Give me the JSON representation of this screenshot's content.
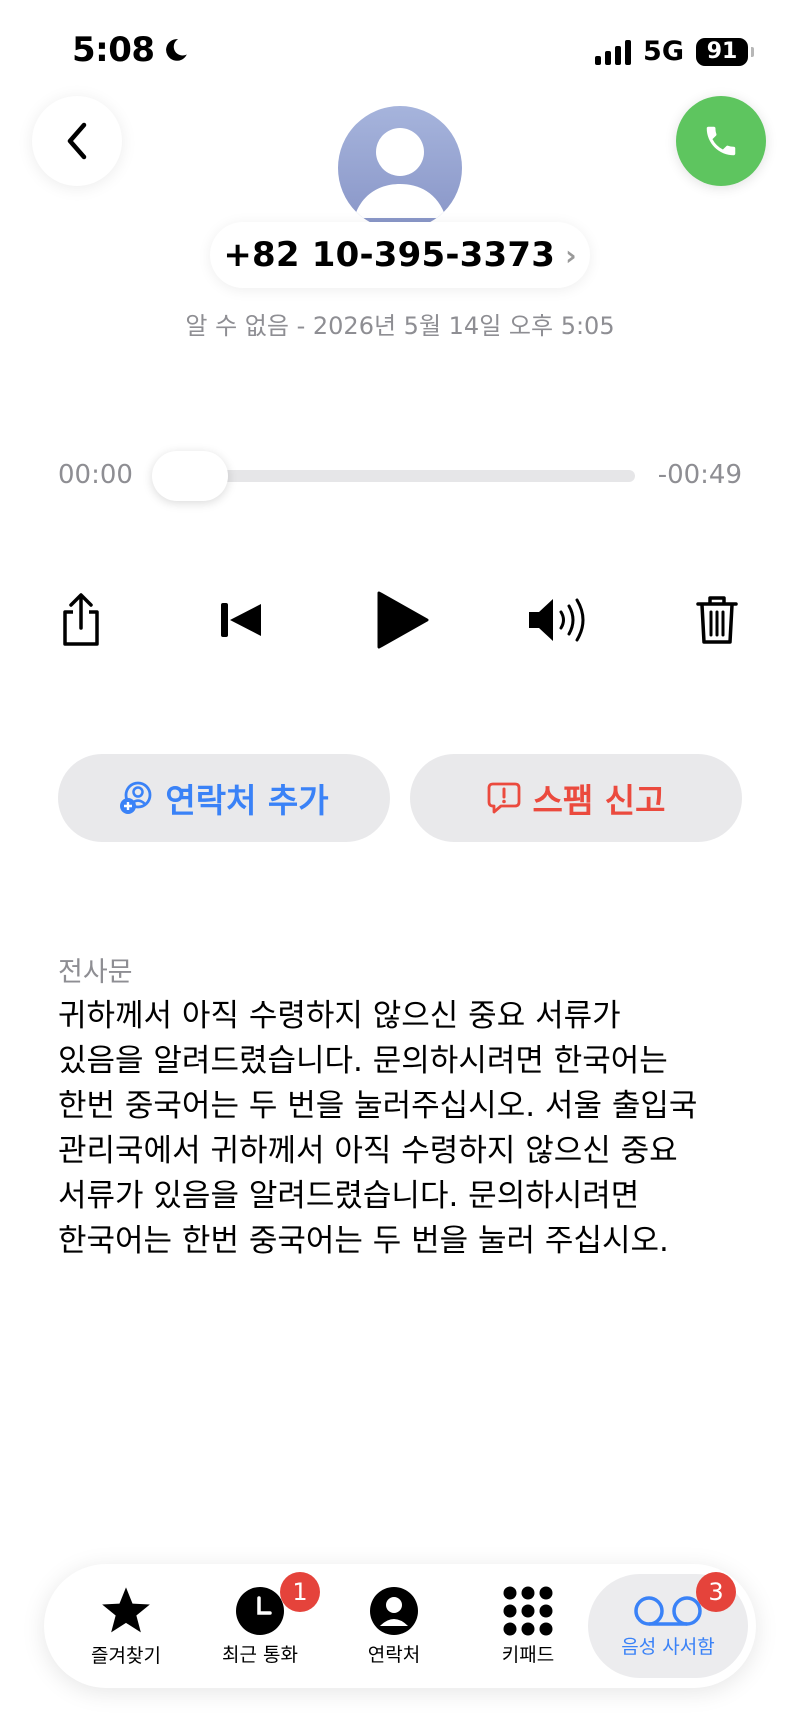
{
  "status_bar": {
    "time": "5:08",
    "network": "5G",
    "battery": "91"
  },
  "header": {
    "phone_number": "+82 10-395-3373",
    "chevron": "›",
    "meta": "알 수 없음 - 2026년 5월 14일 오후 5:05"
  },
  "player": {
    "elapsed": "00:00",
    "remaining": "-00:49",
    "progress": 0
  },
  "actions": {
    "add_contact": "연락처 추가",
    "report_spam": "스팸 신고"
  },
  "transcript": {
    "label": "전사문",
    "text": "귀하께서 아직 수령하지 않으신 중요 서류가\n있음을 알려드렸습니다. 문의하시려면 한국어는\n한번 중국어는 두 번을 눌러주십시오.  서울 출입국\n관리국에서 귀하께서 아직 수령하지 않으신 중요\n서류가 있음을 알려드렸습니다.  문의하시려면\n한국어는 한번 중국어는 두 번을 눌러 주십시오."
  },
  "tabs": [
    {
      "label": "즐겨찾기",
      "icon": "star-icon"
    },
    {
      "label": "최근 통화",
      "icon": "clock-icon",
      "badge": "1"
    },
    {
      "label": "연락처",
      "icon": "person-circle-icon"
    },
    {
      "label": "키패드",
      "icon": "keypad-icon"
    },
    {
      "label": "음성 사서함",
      "icon": "voicemail-icon",
      "badge": "3",
      "active": true
    }
  ],
  "colors": {
    "accent": "#3a82f7",
    "danger": "#eb4a3e",
    "call": "#5ec55f",
    "badge": "#e5433b"
  }
}
